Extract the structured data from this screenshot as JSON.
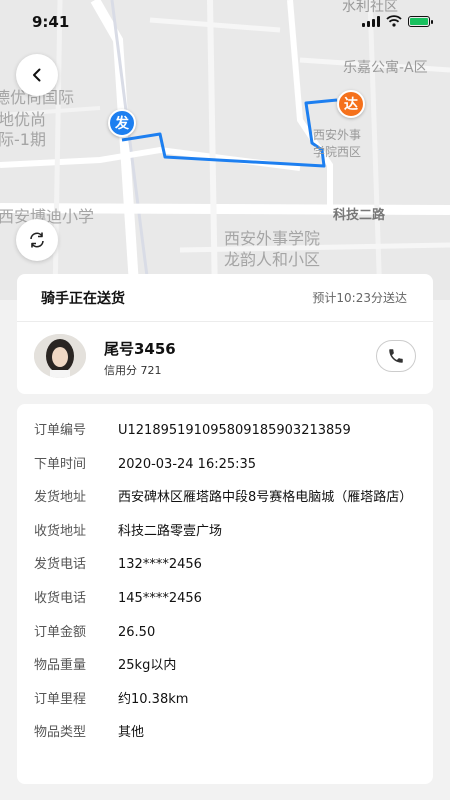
{
  "status_bar": {
    "time": "9:41"
  },
  "map": {
    "labels": {
      "shuili": "水利社区",
      "lejia": "乐嘉公寓-A区",
      "yijiang1": "德优尚国际",
      "yijiang2": "地优尚",
      "yijiang3": "际-1期",
      "xawsh_small1": "西安外事",
      "xawsh_small2": "学院西区",
      "bodi": "西安博迪小学",
      "keji_road": "科技二路",
      "xawsh_big1": "西安外事学院",
      "xawsh_big2": "龙韵人和小区"
    },
    "start_marker": "发",
    "end_marker": "达",
    "route_color": "#1d7ff0"
  },
  "status": {
    "title": "骑手正在送货",
    "eta": "预计10:23分送达"
  },
  "rider": {
    "name": "尾号3456",
    "credit_label": "信用分",
    "credit_value": "721"
  },
  "details": [
    {
      "label": "订单编号",
      "value": "U1218951910958091859032138​59"
    },
    {
      "label": "下单时间",
      "value": "2020-03-24 16:25:35"
    },
    {
      "label": "发货地址",
      "value": "西安碑林区雁塔路中段8号赛格电脑城（雁塔路店）"
    },
    {
      "label": "收货地址",
      "value": "科技二路零壹广场"
    },
    {
      "label": "发货电话",
      "value": "132****2456"
    },
    {
      "label": "收货电话",
      "value": "145****2456"
    },
    {
      "label": "订单金额",
      "value": "26.50"
    },
    {
      "label": "物品重量",
      "value": "25kg以内"
    },
    {
      "label": "订单里程",
      "value": "约10.38km"
    },
    {
      "label": "物品类型",
      "value": "其他"
    }
  ]
}
